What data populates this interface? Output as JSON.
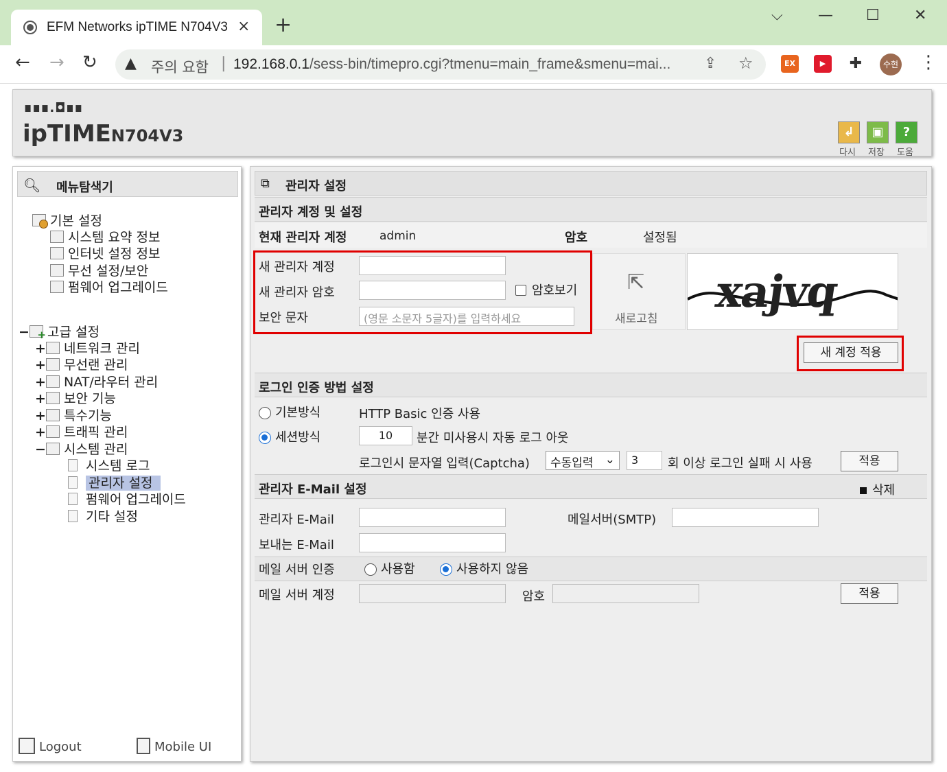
{
  "browser": {
    "tab_title": "EFM Networks ipTIME N704V3",
    "tab_close": "×",
    "new_tab": "+",
    "warning_label": "주의 요함",
    "url_main": "192.168.0.1",
    "url_path": "/sess-bin/timepro.cgi?tmenu=main_frame&smenu=mai...",
    "ext1": "EX",
    "avatar": "수현"
  },
  "header": {
    "logo_dots": "∎∎∎.◘∎∎",
    "logo": "ipTIME",
    "model": "N704V3",
    "btn_redo": "다시",
    "btn_save": "저장",
    "btn_help": "도움",
    "help_glyph": "?"
  },
  "sidebar": {
    "title": "메뉴탐색기",
    "basic": {
      "label": "기본 설정",
      "items": [
        "시스템 요약 정보",
        "인터넷 설정 정보",
        "무선 설정/보안",
        "펌웨어 업그레이드"
      ]
    },
    "advanced": {
      "toggle": "−",
      "label": "고급 설정",
      "items": [
        {
          "toggle": "+",
          "label": "네트워크 관리"
        },
        {
          "toggle": "+",
          "label": "무선랜 관리"
        },
        {
          "toggle": "+",
          "label": "NAT/라우터 관리"
        },
        {
          "toggle": "+",
          "label": "보안 기능"
        },
        {
          "toggle": "+",
          "label": "특수기능"
        },
        {
          "toggle": "+",
          "label": "트래픽 관리"
        },
        {
          "toggle": "−",
          "label": "시스템 관리"
        }
      ],
      "system_children": [
        "시스템 로그",
        "관리자 설정",
        "펌웨어 업그레이드",
        "기타 설정"
      ]
    },
    "logout": "Logout",
    "mobile": "Mobile UI"
  },
  "main": {
    "title": "관리자 설정",
    "account_section": "관리자 계정 및 설정",
    "current_account_label": "현재 관리자 계정",
    "current_account_value": "admin",
    "password_label": "암호",
    "password_status": "설정됨",
    "new_account_label": "새 관리자 계정",
    "new_account_value": "",
    "new_password_label": "새 관리자 암호",
    "new_password_value": "",
    "show_password_label": "암호보기",
    "captcha_label": "보안 문자",
    "captcha_placeholder": "(영문 소문자 5글자)를 입력하세요",
    "refresh_label": "새로고침",
    "captcha_text": "xajvq",
    "apply_new_account": "새 계정 적용",
    "login_section": "로그인 인증 방법 설정",
    "basic_method": "기본방식",
    "basic_method_desc": "HTTP Basic 인증 사용",
    "session_method": "세션방식",
    "session_minutes": "10",
    "session_desc": "분간 미사용시 자동 로그 아웃",
    "captcha_input_label": "로그인시 문자열 입력(Captcha)",
    "captcha_mode": "수동입력",
    "captcha_fail_count": "3",
    "captcha_fail_desc": "회 이상 로그인 실패 시 사용",
    "apply_login": "적용",
    "email_section": "관리자 E-Mail 설정",
    "delete_label": "삭제",
    "admin_email_label": "관리자 E-Mail",
    "admin_email_value": "",
    "smtp_label": "메일서버(SMTP)",
    "smtp_value": "",
    "sender_email_label": "보내는 E-Mail",
    "sender_email_value": "",
    "mail_auth_label": "메일 서버 인증",
    "mail_auth_use": "사용함",
    "mail_auth_nouse": "사용하지 않음",
    "mail_account_label": "메일 서버 계정",
    "mail_password_label": "암호",
    "apply_email": "적용"
  }
}
